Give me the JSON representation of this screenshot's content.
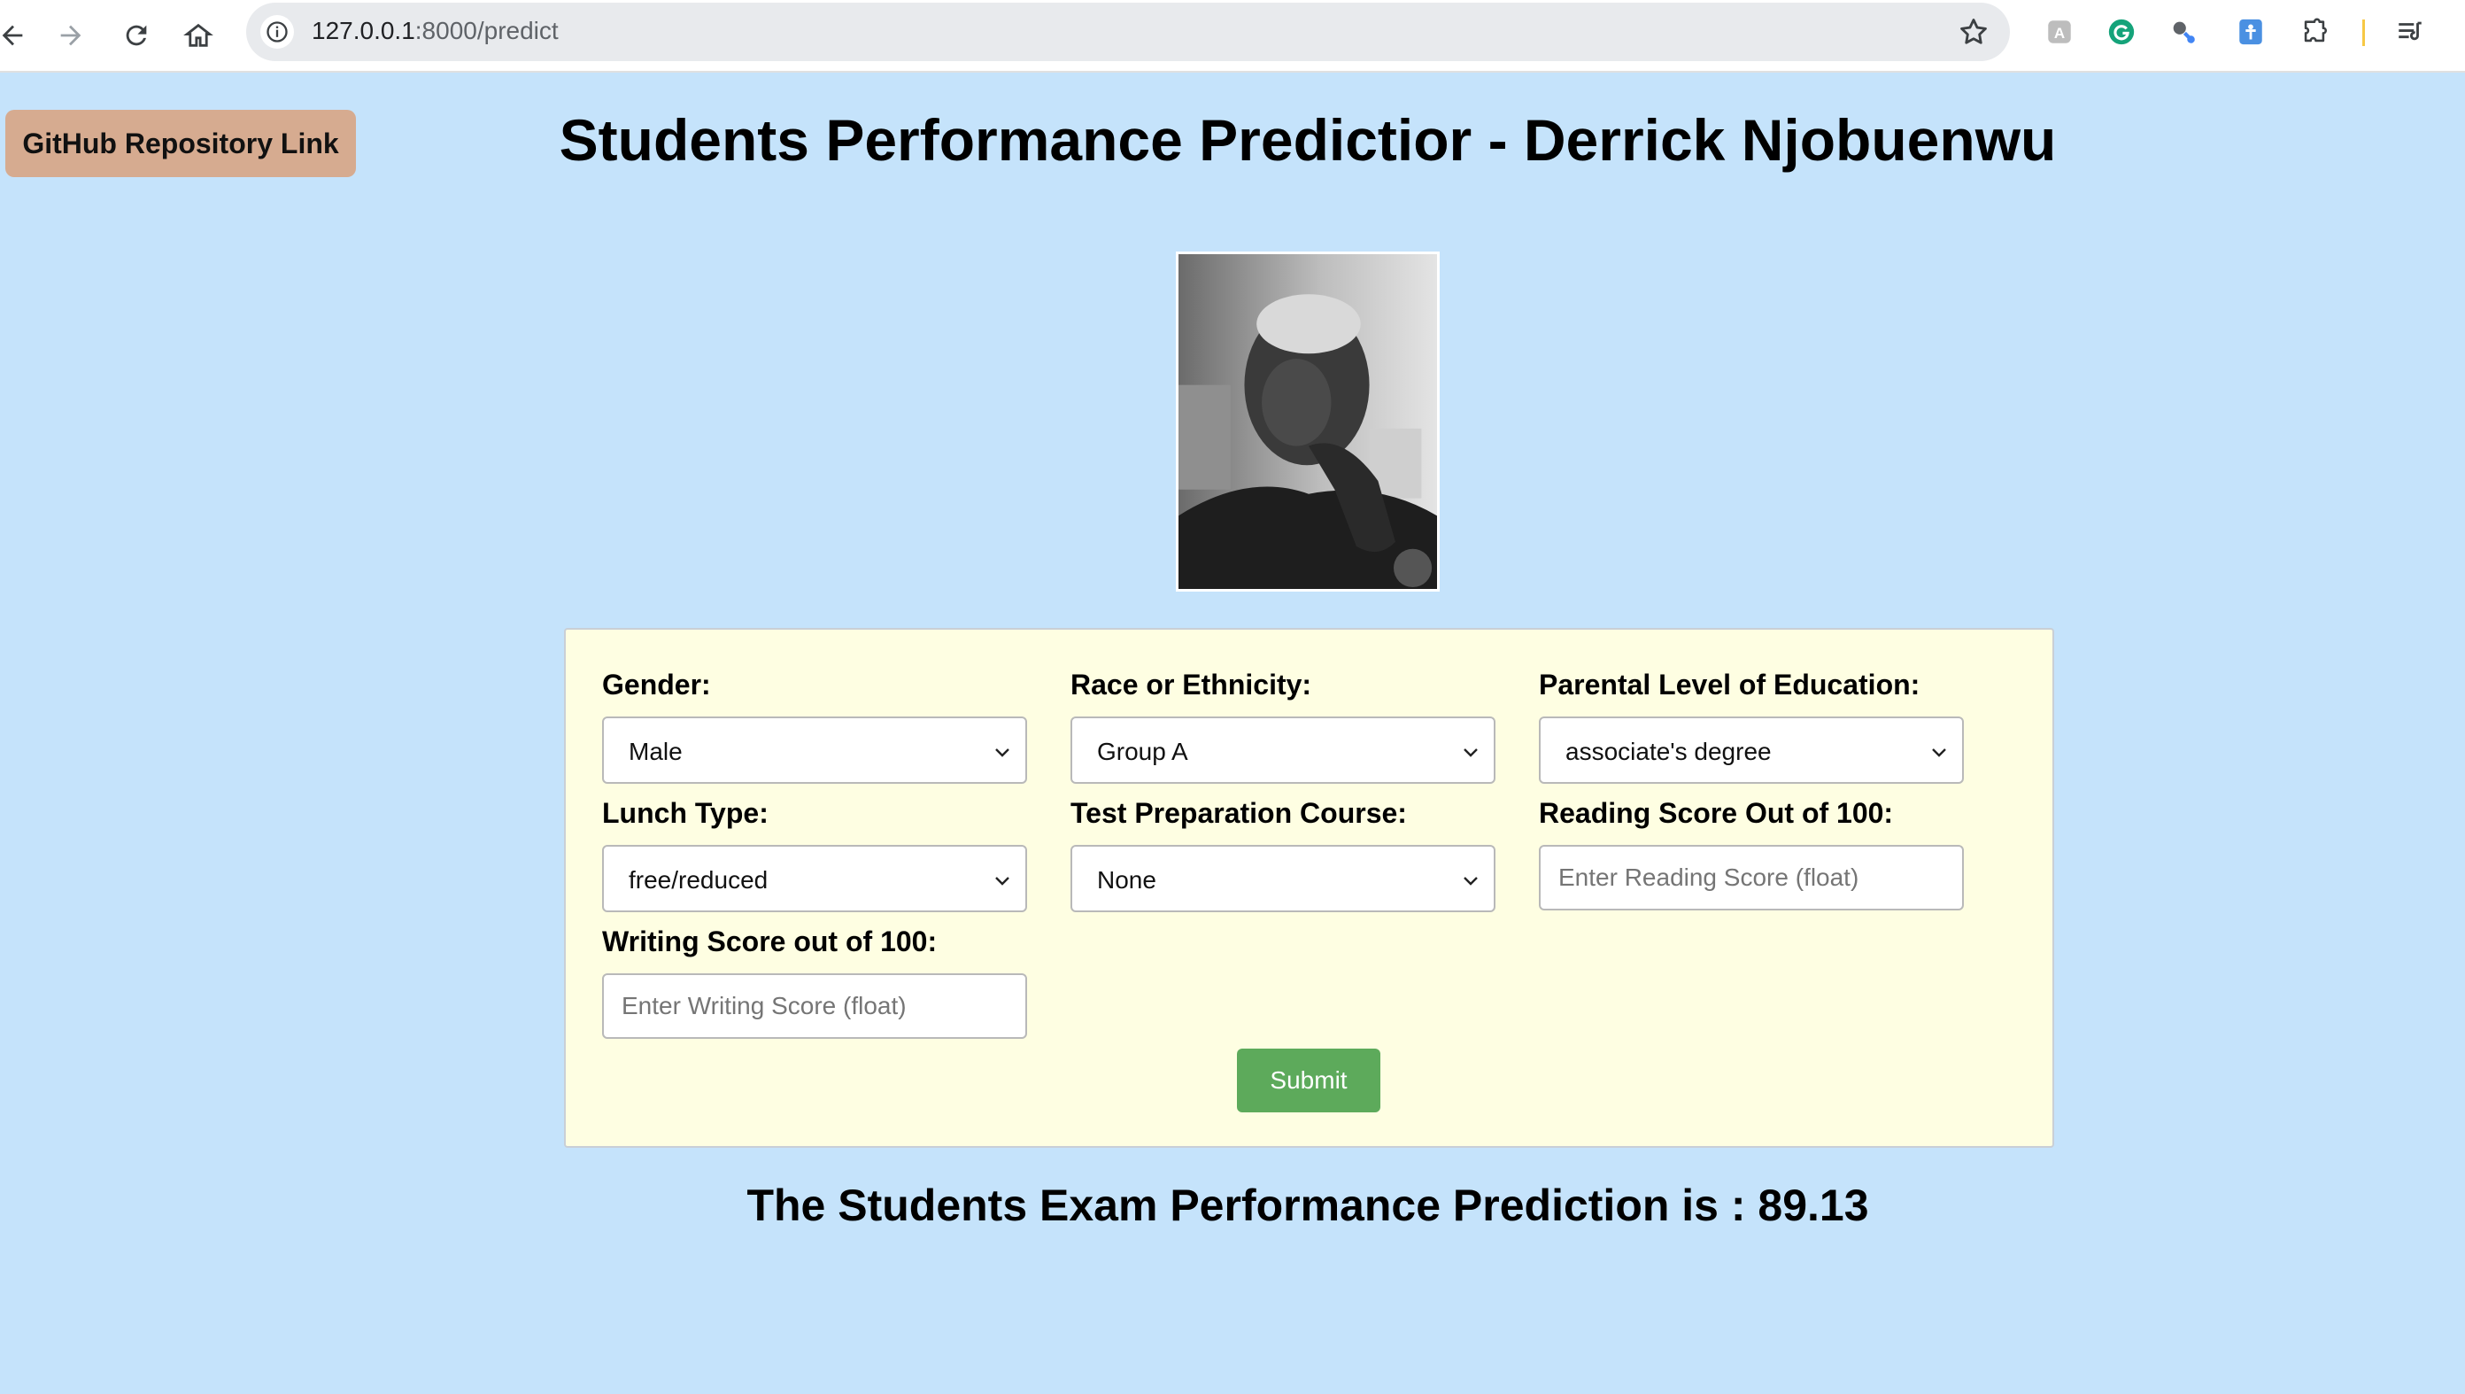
{
  "browser": {
    "url_host": "127.0.0.1",
    "url_rest": ":8000/predict",
    "icons": {
      "back": "back-arrow-icon",
      "forward": "forward-arrow-icon",
      "reload": "reload-icon",
      "home": "home-icon",
      "info": "info-icon",
      "bookmark": "star-icon"
    },
    "extensions": [
      "extension-a-icon",
      "grammarly-icon",
      "extension-satellite-icon",
      "extension-accessibility-icon",
      "puzzle-icon",
      "reading-list-icon"
    ]
  },
  "header": {
    "github_label": "GitHub Repository Link",
    "title": "Students Performance Predictior - Derrick Njobuenwu"
  },
  "form": {
    "gender": {
      "label": "Gender:",
      "value": "Male"
    },
    "race": {
      "label": "Race or Ethnicity:",
      "value": "Group A"
    },
    "parental": {
      "label": "Parental Level of Education:",
      "value": "associate's degree"
    },
    "lunch": {
      "label": "Lunch Type:",
      "value": "free/reduced"
    },
    "test_prep": {
      "label": "Test Preparation Course:",
      "value": "None"
    },
    "reading": {
      "label": "Reading Score Out of 100:",
      "placeholder": "Enter Reading Score (float)",
      "value": ""
    },
    "writing": {
      "label": "Writing Score out of 100:",
      "placeholder": "Enter Writing Score (float)",
      "value": ""
    },
    "submit_label": "Submit"
  },
  "result": {
    "text": "The Students Exam Performance Prediction is : 89.13"
  },
  "colors": {
    "page_bg": "#c5e3fb",
    "card_bg": "#fefee2",
    "github_button": "#d6ab90",
    "submit_button": "#5daa5b"
  }
}
